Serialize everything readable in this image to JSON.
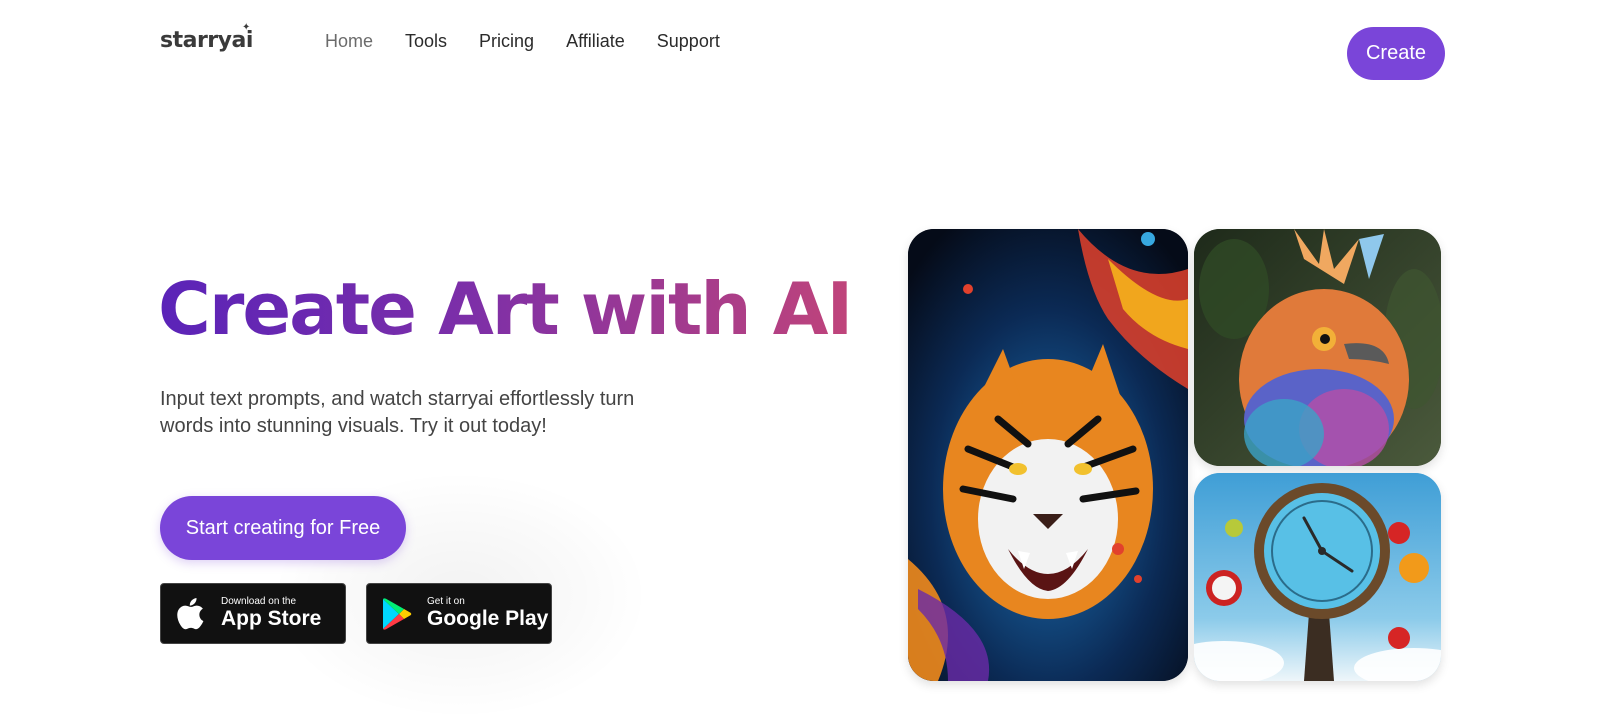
{
  "brand": {
    "logo_text": "starryai"
  },
  "nav": {
    "items": [
      {
        "label": "Home"
      },
      {
        "label": "Tools"
      },
      {
        "label": "Pricing"
      },
      {
        "label": "Affiliate"
      },
      {
        "label": "Support"
      }
    ],
    "create_label": "Create"
  },
  "hero": {
    "title": "Create Art with AI",
    "subtitle": "Input text prompts, and watch starryai effortlessly turn words into stunning visuals. Try it out today!",
    "cta_label": "Start creating for Free"
  },
  "stores": {
    "apple": {
      "small": "Download on the",
      "big": "App Store",
      "icon": "apple-icon"
    },
    "google": {
      "small": "Get it on",
      "big": "Google Play",
      "icon": "google-play-icon"
    }
  },
  "colors": {
    "accent": "#7a45d9",
    "title_gradient_start": "#5a23b8",
    "title_gradient_end": "#c0447a"
  }
}
